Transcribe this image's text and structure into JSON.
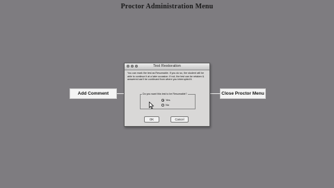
{
  "header": {
    "title": "Proctor Administration Menu",
    "corner_text": ""
  },
  "menu": {
    "left_label": "Add Comment",
    "right_label": "Close Proctor Menu"
  },
  "dialog": {
    "title": "Test Restoration",
    "message": "You can mark the test as Resumable. If you do so, the student will be able to continue it at a later occasion. If not, the test can be retaken & answered can't be continued from where you interrupted it.",
    "question": "Do you want this test to be Resumable?",
    "options": [
      {
        "label": "Yes",
        "selected": true
      },
      {
        "label": "No",
        "selected": false
      }
    ],
    "ok_label": "OK",
    "cancel_label": "Cancel"
  }
}
